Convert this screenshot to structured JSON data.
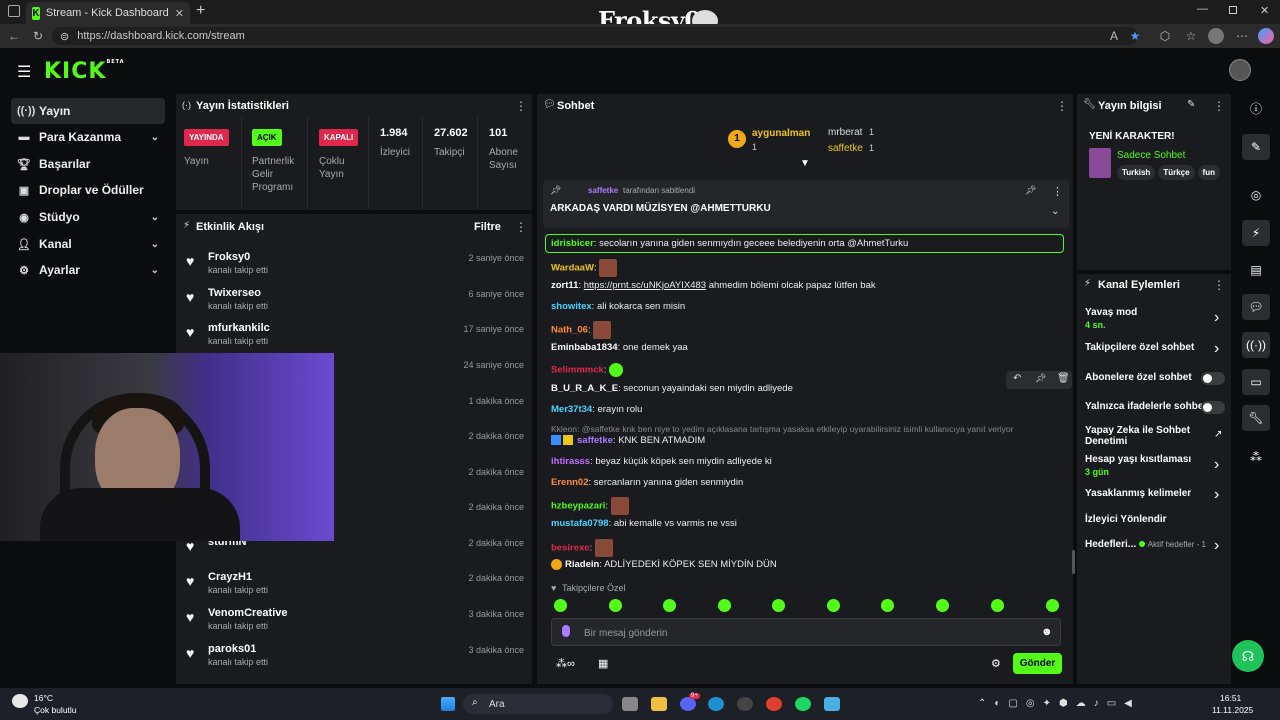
{
  "browser": {
    "tab_title": "Stream - Kick Dashboard",
    "url": "https://dashboard.kick.com/stream",
    "overlay_name": "Froksy0"
  },
  "sidebar": {
    "items": [
      {
        "label": "Yayın",
        "icon": "stream-icon"
      },
      {
        "label": "Para Kazanma",
        "icon": "money-icon"
      },
      {
        "label": "Başarılar",
        "icon": "trophy-icon"
      },
      {
        "label": "Droplar ve Ödüller",
        "icon": "gift-icon"
      },
      {
        "label": "Stüdyo",
        "icon": "studio-icon"
      },
      {
        "label": "Kanal",
        "icon": "person-icon"
      },
      {
        "label": "Ayarlar",
        "icon": "gear-icon"
      }
    ]
  },
  "stats": {
    "title": "Yayın İstatistikleri",
    "live_badge": "YAYINDA",
    "live_label": "Yayın",
    "partner_badge": "AÇIK",
    "partner_label": "Partnerlik Gelir Programı",
    "multi_badge": "KAPALI",
    "multi_label": "Çoklu Yayın",
    "viewers": "1.984",
    "viewers_label": "İzleyici",
    "followers": "27.602",
    "followers_label": "Takipçi",
    "subs": "101",
    "subs_label": "Abone Sayısı"
  },
  "activity": {
    "title": "Etkinlik Akışı",
    "filter": "Filtre",
    "items": [
      {
        "name": "Froksy0",
        "sub": "kanalı takip etti",
        "time": "2 saniye önce"
      },
      {
        "name": "Twixerseo",
        "sub": "kanalı takip etti",
        "time": "6 saniye önce"
      },
      {
        "name": "mfurkankilc",
        "sub": "kanalı takip etti",
        "time": "17 saniye önce"
      },
      {
        "name": "",
        "sub": "",
        "time": "24 saniye önce"
      },
      {
        "name": "",
        "sub": "",
        "time": "1 dakika önce"
      },
      {
        "name": "",
        "sub": "",
        "time": "2 dakika önce"
      },
      {
        "name": "",
        "sub": "",
        "time": "2 dakika önce"
      },
      {
        "name": "",
        "sub": "",
        "time": "2 dakika önce"
      },
      {
        "name": "sturmN",
        "sub": "",
        "time": "2 dakika önce"
      },
      {
        "name": "CrayzH1",
        "sub": "kanalı takip etti",
        "time": "2 dakika önce"
      },
      {
        "name": "VenomCreative",
        "sub": "kanalı takip etti",
        "time": "3 dakika önce"
      },
      {
        "name": "paroks01",
        "sub": "kanalı takip etti",
        "time": "3 dakika önce"
      }
    ]
  },
  "chat": {
    "title": "Sohbet",
    "leader": {
      "rank": "1",
      "name": "aygunalman",
      "count": "1"
    },
    "others": [
      {
        "name": "mrberat",
        "count": "1"
      },
      {
        "name": "saffetke",
        "count": "1"
      }
    ],
    "pinned_by": "saffetke",
    "pinned_suffix": "tarafından sabitlendi",
    "pinned_text": "ARKADAŞ VARDI MÜZİSYEN @AHMETTURKU",
    "messages": [
      {
        "user": "idrisbicer",
        "color": "#53fc18",
        "text": "secoların yanına giden senmıydın geceee belediyenin orta @AhmetTurku"
      },
      {
        "user": "WardaaW",
        "color": "#f0c419",
        "text": ""
      },
      {
        "user": "zort11",
        "color": "#ffffff",
        "link": "https://prnt.sc/uNKjoAYIX483",
        "text": "ahmedim bölemi olcak papaz lütfen bak"
      },
      {
        "user": "showitex",
        "color": "#4bd4ff",
        "text": "ali kokarca sen misin"
      },
      {
        "user": "Nath_06",
        "color": "#ff8c3a",
        "text": ""
      },
      {
        "user": "Eminbaba1834",
        "color": "#ffffff",
        "text": "one demek yaa"
      },
      {
        "user": "Selimmmck",
        "color": "#e0284c",
        "text": ""
      },
      {
        "user": "B_U_R_A_K_E",
        "color": "#ffffff",
        "text": "seconun yayaindaki sen miydin adliyede"
      },
      {
        "user": "Mer37t34",
        "color": "#4bd4ff",
        "text": "erayın rolu"
      },
      {
        "user": "saffetke",
        "color": "#a97bff",
        "text": "KNK BEN ATMADIM"
      },
      {
        "user": "ihtirasss",
        "color": "#c56bff",
        "text": "beyaz küçük köpek sen miydin adliyede ki"
      },
      {
        "user": "Erenn02",
        "color": "#ff8c3a",
        "text": "sercanların yanına giden senmiydin"
      },
      {
        "user": "hzbeypazari",
        "color": "#53fc18",
        "text": ""
      },
      {
        "user": "mustafa0798",
        "color": "#4bd4ff",
        "text": "abi kemalle vs varmis ne vssi"
      },
      {
        "user": "besirexe",
        "color": "#e0284c",
        "text": ""
      },
      {
        "user": "Riadein",
        "color": "#ffffff",
        "text": "ADLİYEDEKİ KÖPEK SEN MİYDİN DÜN"
      }
    ],
    "reply": "Kkleon: @saffetke knk ben niye to yedim açıklasana tartışma yasaksa etkileyip uyarabilirsiniz isimli kullanıcıya yanıt veriyor",
    "followers_only": "Takipçilere Özel",
    "placeholder": "Bir mesaj gönderin",
    "send": "Gönder"
  },
  "info": {
    "title": "Yayın bilgisi",
    "stream_title": "YENİ KARAKTER!",
    "category": "Sadece Sohbet",
    "tags": [
      "Turkish",
      "Türkçe",
      "fun"
    ]
  },
  "actions": {
    "title": "Kanal Eylemleri",
    "items": [
      {
        "label": "Yavaş mod",
        "sub": "4 sn.",
        "type": "arrow"
      },
      {
        "label": "Takipçilere özel sohbet",
        "type": "arrow"
      },
      {
        "label": "Abonelere özel sohbet",
        "type": "toggle"
      },
      {
        "label": "Yalnızca ifadelerle sohbet",
        "type": "toggle"
      },
      {
        "label": "Yapay Zeka ile Sohbet Denetimi",
        "type": "ext"
      },
      {
        "label": "Hesap yaşı kısıtlaması",
        "sub": "3 gün",
        "type": "arrow"
      },
      {
        "label": "Yasaklanmış kelimeler",
        "type": "arrow"
      },
      {
        "label": "İzleyici Yönlendir",
        "type": "none"
      },
      {
        "label": "Hedefleri...",
        "sub": "Aktif hedefler - 1",
        "type": "arrow"
      }
    ]
  },
  "taskbar": {
    "temp": "16°C",
    "weather": "Çok bulutlu",
    "search": "Ara",
    "time": "16:51",
    "date": "11.11.2025",
    "badge": "9+"
  },
  "colors": {
    "accent": "#53fc18",
    "live": "#e0284c",
    "bg": "#0b0c0d",
    "panel": "#191b1f"
  }
}
